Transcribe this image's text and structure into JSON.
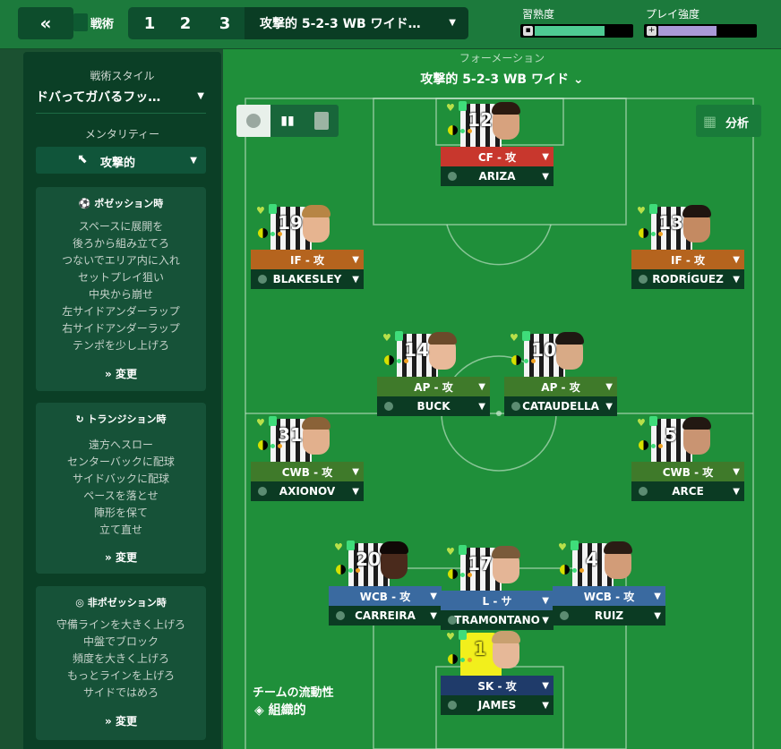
{
  "topbar": {
    "collapse_icon": "«",
    "tactic_label": "戦術",
    "slots": [
      "1",
      "2",
      "3"
    ],
    "selected_tactic": "攻撃的 5-2-3 WB ワイド…",
    "familiarity_label": "習熟度",
    "familiarity_value": 0.72,
    "familiarity_color": "#4ecb93",
    "intensity_label": "プレイ強度",
    "intensity_value": 0.6,
    "intensity_color": "#a99ad8"
  },
  "sidebar": {
    "style_label": "戦術スタイル",
    "style_value": "ドバってガバるフッ…",
    "mentality_label": "メンタリティー",
    "mentality_value": "攻撃的",
    "in_possession": {
      "title": "ポゼッション時",
      "items": [
        "スペースに展開を",
        "後ろから組み立てろ",
        "つないでエリア内に入れ",
        "セットプレイ狙い",
        "中央から崩せ",
        "左サイドアンダーラップ",
        "右サイドアンダーラップ",
        "テンポを少し上げろ"
      ],
      "change_label": "変更"
    },
    "transition": {
      "title": "トランジション時",
      "items": [
        "遠方へスロー",
        "センターバックに配球",
        "サイドバックに配球",
        "ペースを落とせ",
        "陣形を保て",
        "立て直せ"
      ],
      "change_label": "変更"
    },
    "out_of_possession": {
      "title": "非ポゼッション時",
      "items": [
        "守備ラインを大きく上げろ",
        "中盤でブロック",
        "頻度を大きく上げろ",
        "もっとラインを上げろ",
        "サイドではめろ"
      ],
      "change_label": "変更"
    }
  },
  "pitch": {
    "formation_label": "フォーメーション",
    "formation_value": "攻撃的 5-2-3 WB ワイド",
    "analysis_label": "分析",
    "fluidity_title": "チームの流動性",
    "fluidity_value": "組織的",
    "players": [
      {
        "number": "12",
        "role": "CF - 攻",
        "name": "ARIZA",
        "role_color": "#c8372d",
        "kit": "stripes",
        "skin": "#d7a27e",
        "hair": "#2b1a10"
      },
      {
        "number": "19",
        "role": "IF - 攻",
        "name": "BLAKESLEY",
        "role_color": "#b5641e",
        "kit": "stripes",
        "skin": "#e6b490",
        "hair": "#b78545"
      },
      {
        "number": "13",
        "role": "IF - 攻",
        "name": "RODRÍGUEZ",
        "role_color": "#b5641e",
        "kit": "stripes",
        "skin": "#c48a62",
        "hair": "#201510"
      },
      {
        "number": "14",
        "role": "AP - 攻",
        "name": "BUCK",
        "role_color": "#3f7a2a",
        "kit": "stripes",
        "skin": "#e8b999",
        "hair": "#6b4a2a"
      },
      {
        "number": "10",
        "role": "AP - 攻",
        "name": "CATAUDELLA",
        "role_color": "#3f7a2a",
        "kit": "stripes",
        "skin": "#d8aa86",
        "hair": "#1f1712"
      },
      {
        "number": "31",
        "role": "CWB - 攻",
        "name": "AXIONOV",
        "role_color": "#3f7a2a",
        "kit": "stripes",
        "skin": "#e2b08d",
        "hair": "#8a6238"
      },
      {
        "number": "5",
        "role": "CWB - 攻",
        "name": "ARCE",
        "role_color": "#3f7a2a",
        "kit": "stripes",
        "skin": "#c99472",
        "hair": "#221812"
      },
      {
        "number": "20",
        "role": "WCB - 攻",
        "name": "CARREIRA",
        "role_color": "#3a6aa0",
        "kit": "stripes",
        "skin": "#4a2a1c",
        "hair": "#100806"
      },
      {
        "number": "17",
        "role": "L - サ",
        "name": "TRAMONTANO",
        "role_color": "#3a6aa0",
        "kit": "stripes",
        "skin": "#e4b596",
        "hair": "#7a5a3a"
      },
      {
        "number": "4",
        "role": "WCB - 攻",
        "name": "RUIZ",
        "role_color": "#3a6aa0",
        "kit": "stripes",
        "skin": "#d29c78",
        "hair": "#2a1c14"
      },
      {
        "number": "1",
        "role": "SK - 攻",
        "name": "JAMES",
        "role_color": "#1f3b6a",
        "kit": "yellow",
        "skin": "#e6b898",
        "hair": "#c8a070"
      }
    ]
  }
}
